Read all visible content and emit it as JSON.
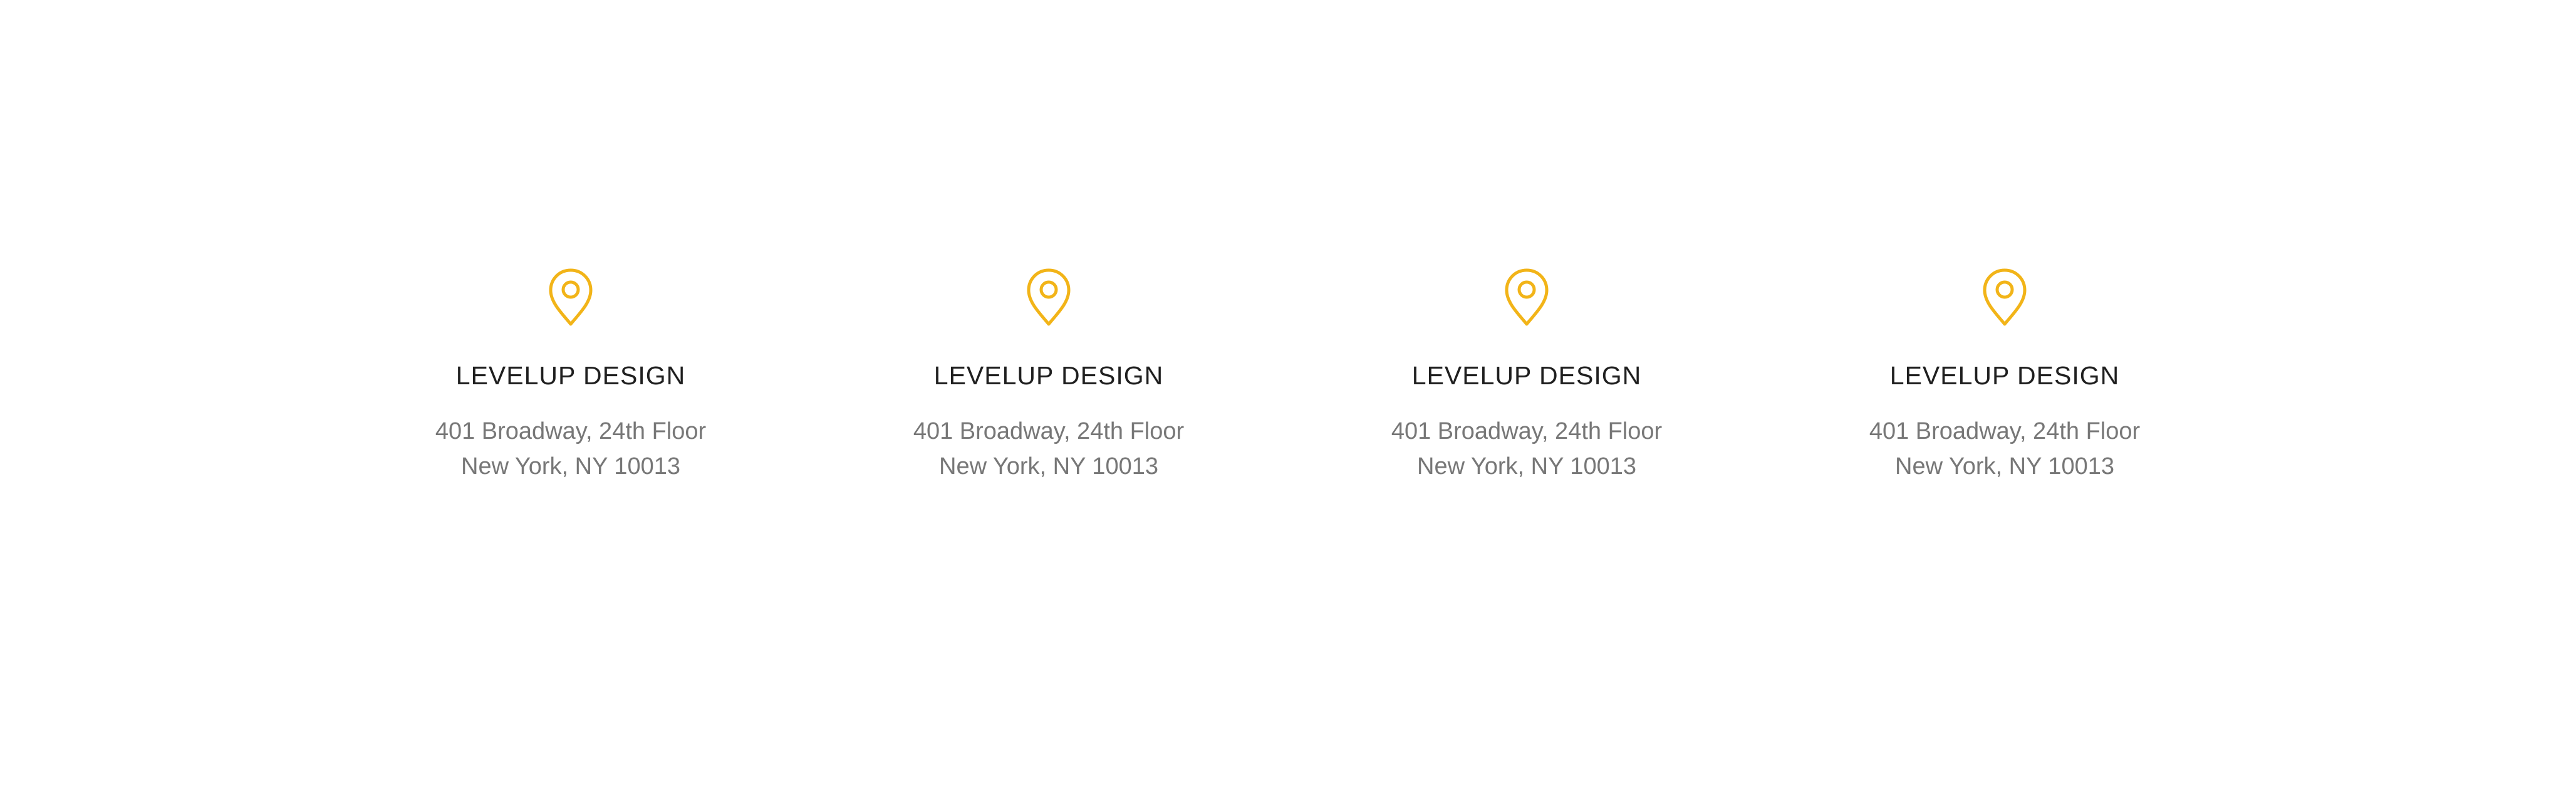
{
  "accent_color": "#f2b418",
  "locations": [
    {
      "icon": "map-pin-icon",
      "title": "LEVELUP DESIGN",
      "address_line1": "401 Broadway, 24th Floor",
      "address_line2": "New York, NY 10013"
    },
    {
      "icon": "map-pin-icon",
      "title": "LEVELUP DESIGN",
      "address_line1": "401 Broadway, 24th Floor",
      "address_line2": "New York, NY 10013"
    },
    {
      "icon": "map-pin-icon",
      "title": "LEVELUP DESIGN",
      "address_line1": "401 Broadway, 24th Floor",
      "address_line2": "New York, NY 10013"
    },
    {
      "icon": "map-pin-icon",
      "title": "LEVELUP DESIGN",
      "address_line1": "401 Broadway, 24th Floor",
      "address_line2": "New York, NY 10013"
    }
  ]
}
